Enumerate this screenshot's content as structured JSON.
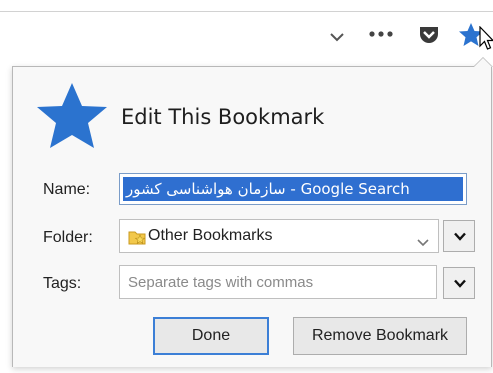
{
  "toolbar": {
    "icons": [
      "chevron-down-icon",
      "more-icon",
      "pocket-icon",
      "bookmark-star-icon"
    ]
  },
  "dialog": {
    "title": "Edit This Bookmark",
    "name_label": "Name:",
    "name_value": "سازمان هواشناسی کشور - Google Search",
    "folder_label": "Folder:",
    "folder_value": "Other Bookmarks",
    "tags_label": "Tags:",
    "tags_placeholder": "Separate tags with commas",
    "done_label": "Done",
    "remove_label": "Remove Bookmark"
  },
  "colors": {
    "accent": "#2f6fd0",
    "star": "#2b73cf",
    "panel_bg": "#f8f8f8"
  }
}
